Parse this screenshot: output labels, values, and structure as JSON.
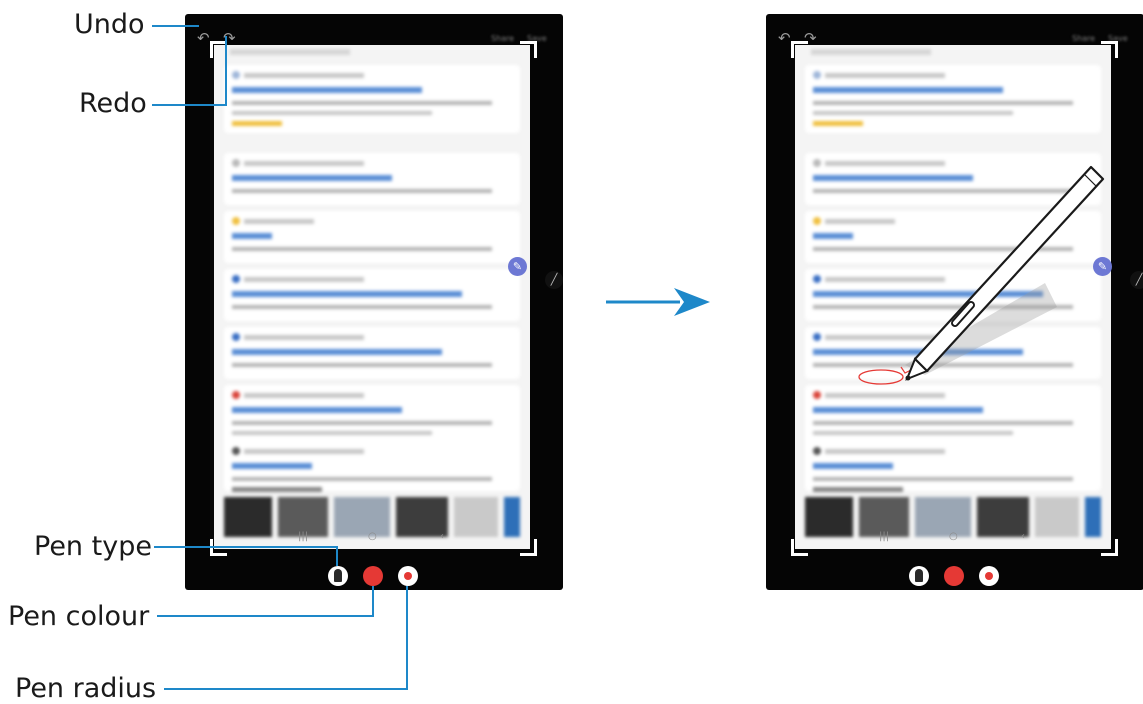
{
  "callouts": {
    "undo": "Undo",
    "redo": "Redo",
    "pen_type": "Pen type",
    "pen_colour": "Pen colour",
    "pen_radius": "Pen radius"
  },
  "toolbar": {
    "undo_icon": "↶",
    "redo_icon": "↷",
    "share_label": "Share",
    "save_label": "Save"
  },
  "navbar": {
    "recent_icon": "|||",
    "home_icon": "○",
    "back_icon": "‹"
  },
  "icons": {
    "edit": "✎",
    "side_handle": "╱"
  },
  "colors": {
    "accent_line": "#1e88c9",
    "pen_colour": "#e53935",
    "link_blue": "#5b8fd6"
  }
}
